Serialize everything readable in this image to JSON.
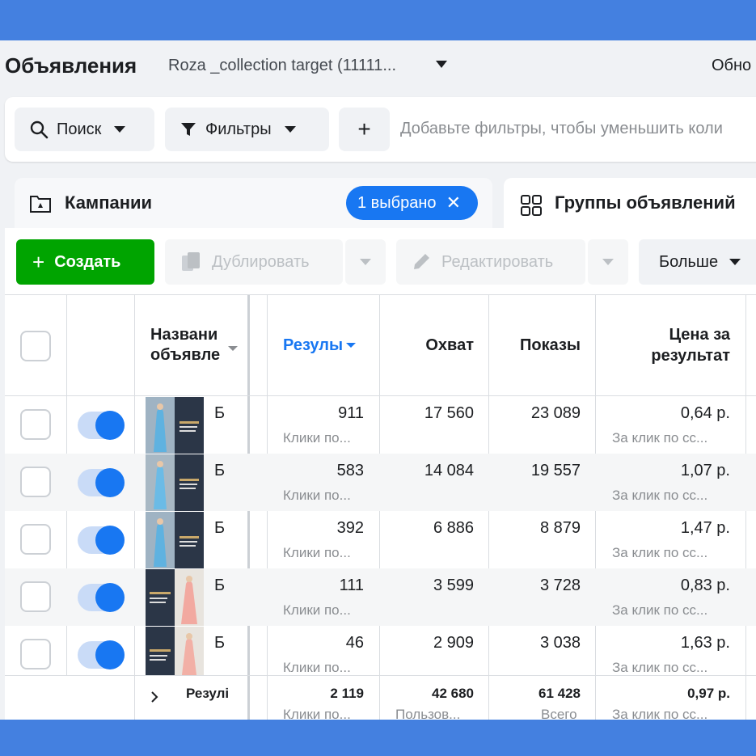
{
  "header": {
    "title": "Объявления",
    "account": "Roza _collection target (11111...",
    "updated_label": "Обно"
  },
  "search": {
    "search_label": "Поиск",
    "filters_label": "Фильтры",
    "add_label": "+",
    "filter_hint": "Добавьте фильтры, чтобы уменьшить коли"
  },
  "tabs": {
    "campaigns": "Кампании",
    "selected_chip": "1 выбрано",
    "adsets": "Группы объявлений"
  },
  "toolbar": {
    "create": "Создать",
    "duplicate": "Дублировать",
    "edit": "Редактировать",
    "more": "Больше"
  },
  "table": {
    "col_name_line1": "Названи",
    "col_name_line2": "объявле",
    "col_results": "Резулы",
    "col_reach": "Охват",
    "col_impressions": "Показы",
    "col_cost_line1": "Цена за",
    "col_cost_line2": "результат",
    "rows": [
      {
        "name": "Б",
        "results": "911",
        "results_sub": "Клики по...",
        "reach": "17 560",
        "impressions": "23 089",
        "cost": "0,64 р.",
        "cost_sub": "За клик по сс..."
      },
      {
        "name": "Б",
        "results": "583",
        "results_sub": "Клики по...",
        "reach": "14 084",
        "impressions": "19 557",
        "cost": "1,07 р.",
        "cost_sub": "За клик по сс..."
      },
      {
        "name": "Б",
        "results": "392",
        "results_sub": "Клики по...",
        "reach": "6 886",
        "impressions": "8 879",
        "cost": "1,47 р.",
        "cost_sub": "За клик по сс..."
      },
      {
        "name": "Б",
        "results": "111",
        "results_sub": "Клики по...",
        "reach": "3 599",
        "impressions": "3 728",
        "cost": "0,83 р.",
        "cost_sub": "За клик по сс..."
      },
      {
        "name": "Б",
        "results": "46",
        "results_sub": "Клики по...",
        "reach": "2 909",
        "impressions": "3 038",
        "cost": "1,63 р.",
        "cost_sub": "За клик по сс..."
      }
    ],
    "totals": {
      "label": "Резулі",
      "results": "2 119",
      "results_sub": "Клики по...",
      "reach": "42 680",
      "reach_sub": "Пользов...",
      "impressions": "61 428",
      "impressions_sub": "Всего",
      "cost": "0,97 р.",
      "cost_sub": "За клик по сс..."
    }
  },
  "colors": {
    "band": "#4480e0",
    "primary": "#1877f2",
    "create_green": "#00a400"
  }
}
